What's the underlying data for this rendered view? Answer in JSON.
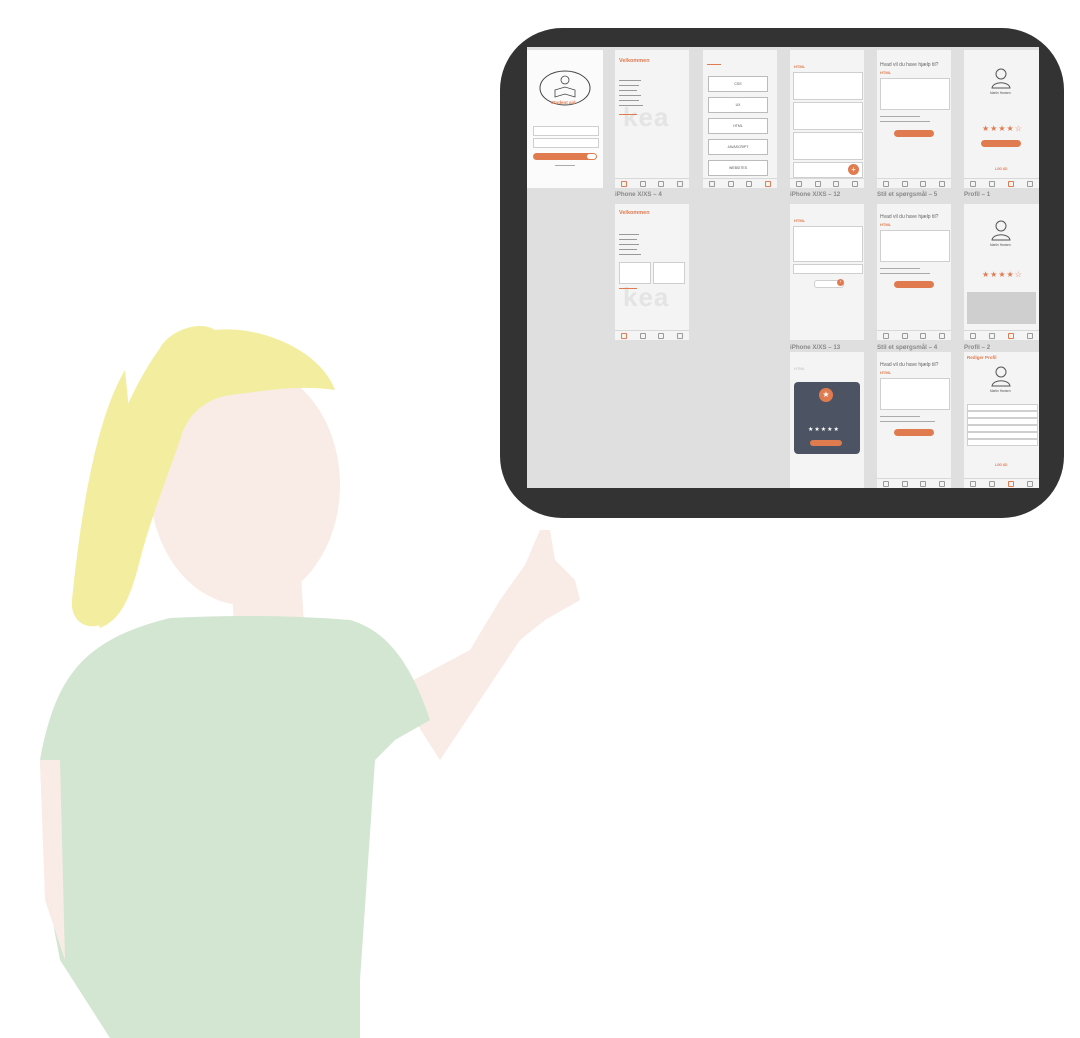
{
  "labels": {
    "phone4": "iPhone X/XS – 4",
    "phone12": "iPhone X/XS – 12",
    "phone13": "iPhone X/XS – 13",
    "stil5": "Stil et spørgsmål – 5",
    "stil4": "Stil et spørgsmål – 4",
    "profil1": "Profil – 1",
    "profil2": "Profil – 2"
  },
  "login": {
    "logo_text": "Student aid"
  },
  "welcome": {
    "title": "Velkommen",
    "watermark": "kea"
  },
  "categories": {
    "items": [
      "CSS",
      "UX",
      "HTML",
      "JAVASCRIPT",
      "WEBSITES"
    ]
  },
  "question": {
    "tag": "HTML",
    "heading": "Hvad vil du have hjælp til?"
  },
  "popup": {
    "stars": "★★★★★"
  },
  "profile": {
    "name": "Martin Hansen",
    "stars": "★★★★☆",
    "logout": "LOG UD",
    "edit_title": "Rediger Profil"
  },
  "colors": {
    "accent": "#e07b4f",
    "frame": "#333333",
    "hair": "#f3ee9f",
    "shirt": "#d2e6d2",
    "skin": "#f9ebe6"
  }
}
